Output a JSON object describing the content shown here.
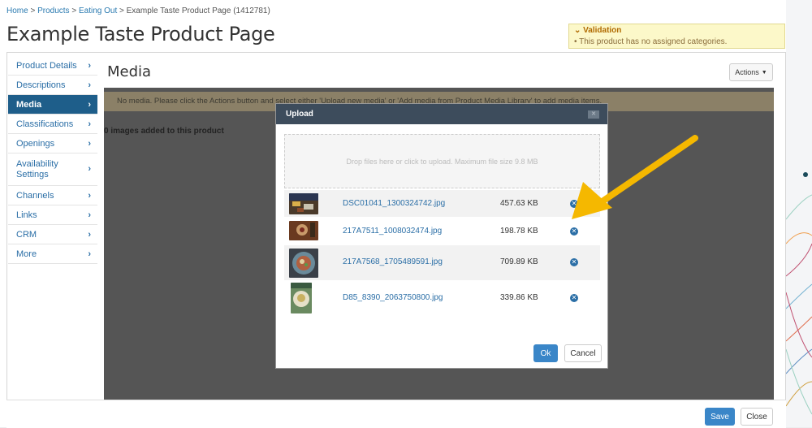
{
  "breadcrumb": {
    "home": "Home",
    "sep": ">",
    "products": "Products",
    "eating_out": "Eating Out",
    "current": "Example Taste Product Page (1412781)"
  },
  "page": {
    "title": "Example Taste Product Page"
  },
  "validation": {
    "heading": "Validation",
    "message": "This product has no assigned categories."
  },
  "sidebar": {
    "items": [
      {
        "label": "Product Details"
      },
      {
        "label": "Descriptions"
      },
      {
        "label": "Media"
      },
      {
        "label": "Classifications"
      },
      {
        "label": "Openings"
      },
      {
        "label": "Availability Settings"
      },
      {
        "label": "Channels"
      },
      {
        "label": "Links"
      },
      {
        "label": "CRM"
      },
      {
        "label": "More"
      }
    ]
  },
  "main": {
    "title": "Media",
    "actions_label": "Actions",
    "notice": "No media. Please click the Actions button and select either 'Upload new media' or 'Add media from Product Media Library' to add media items.",
    "images_added": "0 images added to this product"
  },
  "footer": {
    "save_label": "Save",
    "close_label": "Close"
  },
  "modal": {
    "title": "Upload",
    "dropzone_text": "Drop files here or click to upload. Maximum file size 9.8 MB",
    "files": [
      {
        "name": "DSC01041_1300324742.jpg",
        "size": "457.63 KB"
      },
      {
        "name": "217A7511_1008032474.jpg",
        "size": "198.78 KB"
      },
      {
        "name": "217A7568_1705489591.jpg",
        "size": "709.89 KB"
      },
      {
        "name": "D85_8390_2063750800.jpg",
        "size": "339.86 KB"
      }
    ],
    "ok_label": "Ok",
    "cancel_label": "Cancel"
  },
  "colors": {
    "accent": "#1e5e8a",
    "link": "#2a6ea6",
    "primary_button": "#3a86c8",
    "modal_header": "#3d4c5c",
    "annotation_arrow": "#f5b800"
  }
}
